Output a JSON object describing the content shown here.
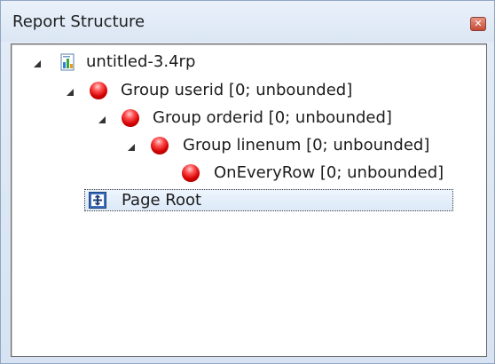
{
  "panel": {
    "title": "Report Structure",
    "close_icon": "close-icon"
  },
  "tree": {
    "root": {
      "label": "untitled-3.4rp",
      "icon": "report-file-icon",
      "expanded": true
    },
    "groups": [
      {
        "label": "Group userid [0; unbounded]",
        "icon": "red-ball-icon",
        "expanded": true
      },
      {
        "label": "Group orderid [0; unbounded]",
        "icon": "red-ball-icon",
        "expanded": true
      },
      {
        "label": "Group linenum [0; unbounded]",
        "icon": "red-ball-icon",
        "expanded": true
      }
    ],
    "leaf": {
      "label": "OnEveryRow [0; unbounded]",
      "icon": "red-ball-icon"
    },
    "page_root": {
      "label": "Page Root",
      "icon": "page-root-icon",
      "selected": true
    }
  },
  "colors": {
    "ball": "#d40000",
    "selection_border": "#404040",
    "panel_bg": "#dbe6f4"
  }
}
